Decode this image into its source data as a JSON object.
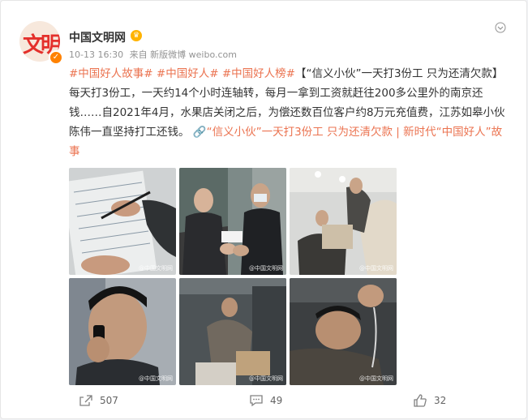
{
  "post": {
    "author": "中国文明网",
    "time": "10-13 16:30",
    "source": "来自 新版微博 weibo.com",
    "tags": [
      "#中国好人故事#",
      "#中国好人#",
      "#中国好人榜#"
    ],
    "title": "【“信义小伙”一天打3份工 只为还清欠款】",
    "body": "每天打3份工，一天约14个小时连轴转，每月一拿到工资就赶往200多公里外的南京还钱……自2021年4月，水果店关闭之后，为偿还数百位客户约8万元充值费，江苏如皋小伙陈伟一直坚持打工还钱。",
    "link": "“信义小伙”一天打3份工 只为还清欠款 | 新时代“中国好人”故事",
    "avatar_text": "文明",
    "watermark": "@中国文明网"
  },
  "actions": {
    "repost_count": "507",
    "comment_count": "49",
    "like_count": "32"
  },
  "icons": {
    "more": "chevron-down-icon",
    "repost": "share-icon",
    "comment": "comment-icon",
    "like": "thumbs-up-icon",
    "verified": "verified-badge-icon"
  },
  "colors": {
    "accent": "#eb7350",
    "text": "#333333",
    "muted": "#939393",
    "verified": "#ff8200"
  }
}
